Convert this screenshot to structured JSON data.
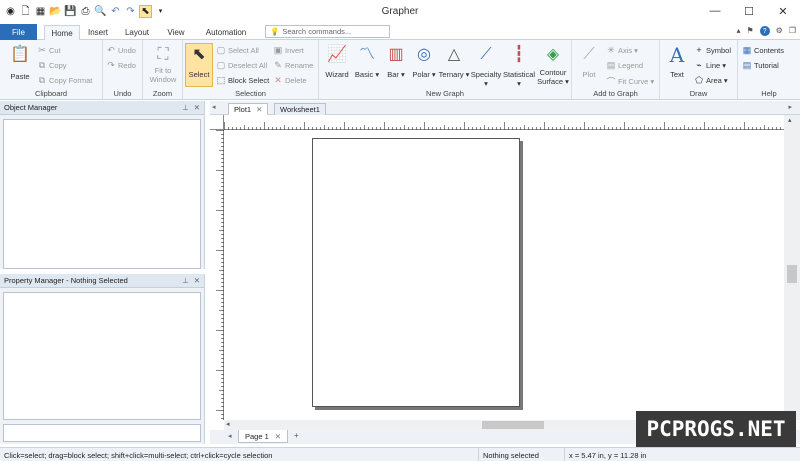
{
  "window": {
    "title": "Grapher",
    "controls": {
      "minimize": "—",
      "maximize": "☐",
      "close": "✕"
    }
  },
  "qat": {
    "icons": [
      "app-menu-icon",
      "new-icon",
      "new-worksheet-icon",
      "open-icon",
      "save-icon",
      "print-icon",
      "preview-icon",
      "undo-icon",
      "redo-icon",
      "select-icon",
      "customize-icon"
    ]
  },
  "tabs": {
    "file": "File",
    "items": [
      "Home",
      "Insert",
      "Layout",
      "View",
      "Automation"
    ],
    "active": "Home"
  },
  "search": {
    "placeholder": "Search commands..."
  },
  "ribbon": {
    "clipboard": {
      "label": "Clipboard",
      "paste": "Paste",
      "cut": "Cut",
      "copy": "Copy",
      "copy_format": "Copy Format"
    },
    "undo": {
      "label": "Undo",
      "undo": "Undo",
      "redo": "Redo"
    },
    "zoom": {
      "label": "Zoom",
      "fit_to_window": "Fit to Window"
    },
    "selection": {
      "label": "Selection",
      "select": "Select",
      "select_all": "Select All",
      "deselect_all": "Deselect All",
      "block_select": "Block Select",
      "invert": "Invert",
      "rename": "Rename",
      "delete": "Delete"
    },
    "new_graph": {
      "label": "New Graph",
      "wizard": "Wizard",
      "basic": "Basic",
      "bar": "Bar",
      "polar": "Polar",
      "ternary": "Ternary",
      "specialty": "Specialty",
      "statistical": "Statistical",
      "contour_surface_1": "Contour",
      "contour_surface_2": "Surface"
    },
    "add_to_graph": {
      "label": "Add to Graph",
      "plot": "Plot",
      "axis": "Axis",
      "legend": "Legend",
      "fit_curve": "Fit Curve"
    },
    "draw": {
      "label": "Draw",
      "text": "Text",
      "symbol": "Symbol",
      "line": "Line",
      "area": "Area"
    },
    "help": {
      "label": "Help",
      "contents": "Contents",
      "tutorial": "Tutorial"
    }
  },
  "panels": {
    "object_manager": "Object Manager",
    "property_manager": "Property Manager - Nothing Selected"
  },
  "doc_tabs": [
    "Plot1",
    "Worksheet1"
  ],
  "sheet_tabs": {
    "page": "Page 1",
    "add": "+"
  },
  "status": {
    "hint": "Click=select; drag=block select; shift+click=multi-select; ctrl+click=cycle selection",
    "selection": "Nothing selected",
    "coords": "x = 5.47 in, y = 11.28 in"
  },
  "watermark": "PCPROGS.NET",
  "colors": {
    "file_tab": "#2a6db8",
    "ribbon_bg": "#f3f6fa",
    "select_highlight": "#ffe3a0"
  }
}
